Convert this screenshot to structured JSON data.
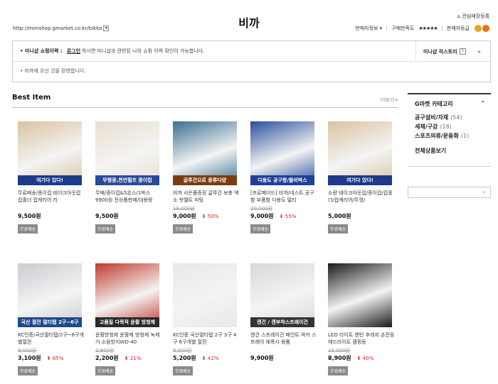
{
  "header": {
    "url": "http://minishop.gmarket.co.kr/bikka",
    "title": "비까",
    "fav_label": "관심매장등록",
    "seller_info": "판매자정보",
    "rating_label": "구매만족도",
    "stars": "★★★★★",
    "grade_label": "판매자등급"
  },
  "mini": {
    "label": "미니샵 쇼핑이력",
    "login": "로그인",
    "message": "하시면 미니샵과 관련된 나의 쇼핑 이력 확인이 가능합니다.",
    "history": "미니샵 히스토리",
    "welcome": "비까에 오신 것을 환영합니다."
  },
  "best": {
    "title": "Best Item",
    "more": "더보기+"
  },
  "items": [
    {
      "band": "여기다 있다!",
      "band_color": "#1d3a8a",
      "name": "무료배송/종이컵 테이크아웃컵 컵홀더 컵캐리어 리",
      "orig": "",
      "price": "9,500원",
      "disc": "",
      "badge": "무료배송"
    },
    {
      "band": "무형광,천연펄프 종이컵",
      "band_color": "#2c4a96",
      "name": "무배/종이컵&5온스/1박스 9900원 전상품판매/대용량",
      "orig": "",
      "price": "9,500원",
      "disc": "",
      "badge": "무료배송"
    },
    {
      "band": "글루건으로 종류다양",
      "band_color": "#7a3d10",
      "name": "비까 사은품증정 글루건 보충 액소 핫멜트 미팅",
      "orig": "18,000원",
      "price": "9,000원",
      "disc": "50%",
      "badge": "무료배송"
    },
    {
      "band": "다용도 공구함/플비박스",
      "band_color": "#1e3f9a",
      "name": "[프로메이드] 비까/네스트 공구함 부품함 다용도 멀티",
      "orig": "20,000원",
      "price": "9,000원",
      "disc": "55%",
      "badge": "무료배송"
    },
    {
      "band": "여기다 있다!",
      "band_color": "#1d3a8a",
      "name": "소량 테이크아웃컵/종이컵/컵홀더/컵캐리어/뚜껑/",
      "orig": "",
      "price": "5,000원",
      "disc": "",
      "badge": "무료배송"
    },
    {
      "band": "국산 절전 멀티탭 2구~6구",
      "band_color": "#1e4a8a",
      "name": "KC인증/국산멀티탭/2구~6구개별절전",
      "orig": "9,000원",
      "price": "3,100원",
      "disc": "65%",
      "badge": "무료배송"
    },
    {
      "band": "고품질 다목적 윤활 방청제",
      "band_color": "#2a2a2a",
      "name": "윤활방청제 윤활제 방청제 녹제거 소음방지WD-40",
      "orig": "2,800원",
      "price": "2,200원",
      "disc": "21%",
      "badge": "무료배송"
    },
    {
      "band": "",
      "band_color": "#6d7a8a",
      "name": "KC인증 국산멀티탭 2구 3구 4구 6구개별 절전",
      "orig": "9,000원",
      "price": "5,200원",
      "disc": "42%",
      "badge": "무료배송"
    },
    {
      "band": "캔건 / 캔부착스프레이건",
      "band_color": "#333333",
      "name": "캔건 스프레이건 페인트 락카 스프레이 에폭시 용품",
      "orig": "",
      "price": "9,900원",
      "disc": "",
      "badge": ""
    },
    {
      "band": "",
      "band_color": "#111111",
      "name": "LED 라이트 랜턴 후레쉬 손전등 헤드라이트 캠핑등",
      "orig": "15,000원",
      "price": "8,900원",
      "disc": "40%",
      "badge": "무료배송"
    }
  ],
  "sidebar": {
    "title": "G마켓 카테고리",
    "items": [
      {
        "label": "공구설비/자재",
        "count": "(54)"
      },
      {
        "label": "세제/구강",
        "count": "(18)"
      },
      {
        "label": "스포츠의류/운동화",
        "count": "(1)"
      }
    ],
    "all": "전체상품보기"
  }
}
